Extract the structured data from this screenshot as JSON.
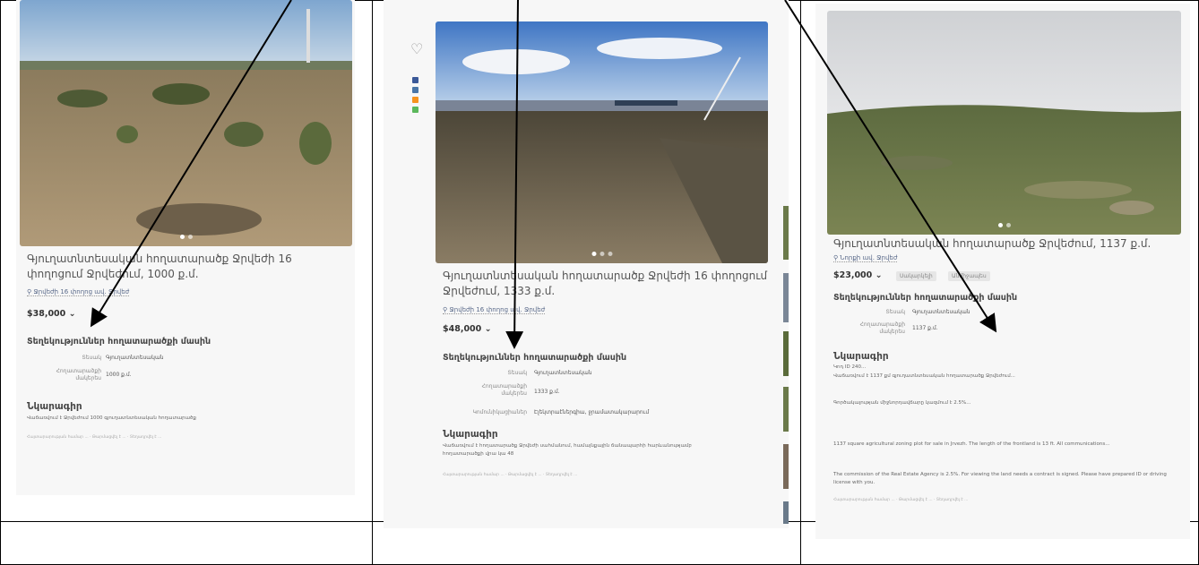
{
  "panels": [
    {
      "views": "",
      "title": "Գյուղատնտեսական հողատարածք Ջրվեժի 16 փողոցում Ջրվեժում, 1000 ք.մ.",
      "location": "Ջրվեժի 16 փողոց ավ. Ջրվեժ",
      "price": "$38,000",
      "features_heading": "Տեղեկություններ հողատարածքի մասին",
      "features": [
        {
          "k": "Տեսակ",
          "v": "Գյուղատնտեսական"
        },
        {
          "k": "Հողատարածքի մակերես",
          "v": "1000 ք.մ."
        }
      ],
      "desc_heading": "Նկարագիր",
      "desc": "Վաճառվում է Ջրվեժում 1000 գյուղատնտեսական հողատարածք",
      "meta": "Հայտարարության համար ... · Թարմացվել է ... · Տեղադրվել է ..."
    },
    {
      "views": "",
      "title": "Գյուղատնտեսական հողատարածք Ջրվեժի 16 փողոցում Ջրվեժում, 1333 ք.մ.",
      "location": "Ջրվեժի 16 փողոց ավ. Ջրվեժ",
      "price": "$48,000",
      "features_heading": "Տեղեկություններ հողատարածքի մասին",
      "features": [
        {
          "k": "Տեսակ",
          "v": "Գյուղատնտեսական"
        },
        {
          "k": "Հողատարածքի մակերես",
          "v": "1333 ք.մ."
        },
        {
          "k": "Կոմունիկացիաներ",
          "v": "Էլեկտրաէներգիա, ջրամատակարարում"
        }
      ],
      "desc_heading": "Նկարագիր",
      "desc": "Վաճառվում է հողատարածք Ջրվեժի սահմանում, համայնքային ճանապարհի հարևանությամբ հողատարածքի վրա կա 48",
      "meta": "Հայտարարության համար ... · Թարմացվել է ... · Տեղադրվել է ..."
    },
    {
      "views": "",
      "title": "Գյուղատնտեսական հողատարածք Ջրվեժում, 1137 ք.մ.",
      "location": "Նորքի ավ. Ջրվեժ",
      "price": "$23,000",
      "tags": [
        "Սակարկելի",
        "Անմիջապես"
      ],
      "features_heading": "Տեղեկություններ հողատարածքի մասին",
      "features": [
        {
          "k": "Տեսակ",
          "v": "Գյուղատնտեսական"
        },
        {
          "k": "Հողատարածքի մակերես",
          "v": "1137 ք.մ."
        }
      ],
      "desc_heading": "Նկարագիր",
      "desc_lines": [
        "Կոդ ID 240...",
        "Վաճառվում է 1137 քմ գյուղատնտեսական հողատարածք Ջրվեժում...",
        "Գործակալության միջնորդավճարը կազմում է 2.5%...",
        "1137 square agricultural zoning plot for sale in Jrvezh. The length of the frontland is 13 ft. All communications...",
        "The commission of the Real Estate Agency is 2.5%. For viewing the land needs a contract is signed. Please have prepared ID or driving license with you."
      ],
      "meta": "Հայտարարության համար ... · Թարմացվել է ... · Տեղադրվել է ..."
    }
  ],
  "colors": {
    "price": "#333333",
    "link": "#5a6a8a",
    "panel_bg": "#f7f7f7"
  }
}
